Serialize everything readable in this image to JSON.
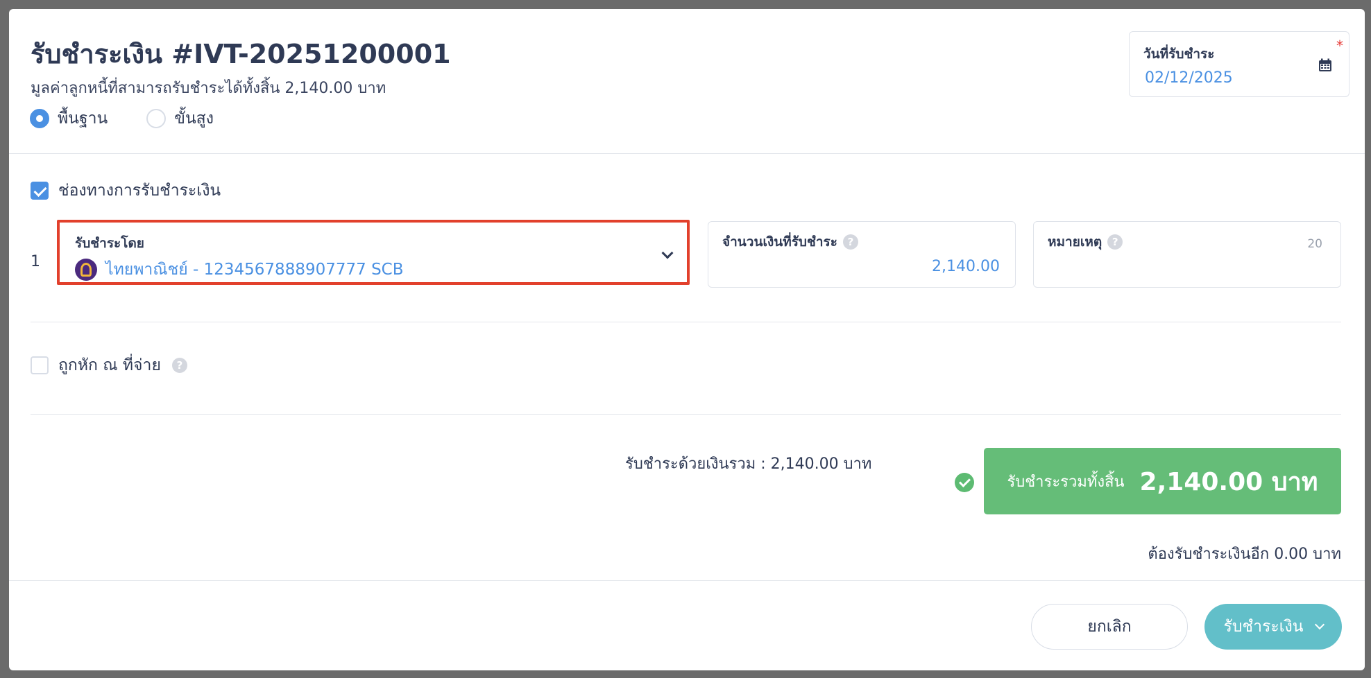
{
  "header": {
    "title": "รับชำระเงิน #IVT-20251200001",
    "subtitle": "มูลค่าลูกหนี้ที่สามารถรับชำระได้ทั้งสิ้น 2,140.00 บาท",
    "modes": [
      {
        "label": "พื้นฐาน",
        "selected": true
      },
      {
        "label": "ขั้นสูง",
        "selected": false
      }
    ]
  },
  "payment_date": {
    "label": "วันที่รับชำระ",
    "required_mark": "*",
    "value": "02/12/2025",
    "icon": "calendar-icon"
  },
  "payment_channel": {
    "checkbox_label": "ช่องทางการรับชำระเงิน",
    "checked": true,
    "rows": [
      {
        "index": "1",
        "pay_by_label": "รับชำระโดย",
        "pay_by_value": "ไทยพาณิชย์ - 1234567888907777 SCB",
        "amount_label": "จำนวนเงินที่รับชำระ",
        "amount_value": "2,140.00",
        "note_label": "หมายเหตุ",
        "note_limit": "20"
      }
    ]
  },
  "withholding": {
    "label": "ถูกหัก ณ ที่จ่าย",
    "checked": false
  },
  "summary": {
    "paid_total_text": "รับชำระด้วยเงินรวม :  2,140.00 บาท",
    "grand_label": "รับชำระรวมทั้งสิ้น",
    "grand_value": "2,140.00 บาท",
    "remaining_text": "ต้องรับชำระเงินอีก 0.00 บาท"
  },
  "footer": {
    "cancel_label": "ยกเลิก",
    "submit_label": "รับชำระเงิน"
  },
  "colors": {
    "accent": "#4a90e2",
    "highlight_border": "#e2402c",
    "total_bg": "#65bd78",
    "submit_bg": "#62bfc9"
  }
}
